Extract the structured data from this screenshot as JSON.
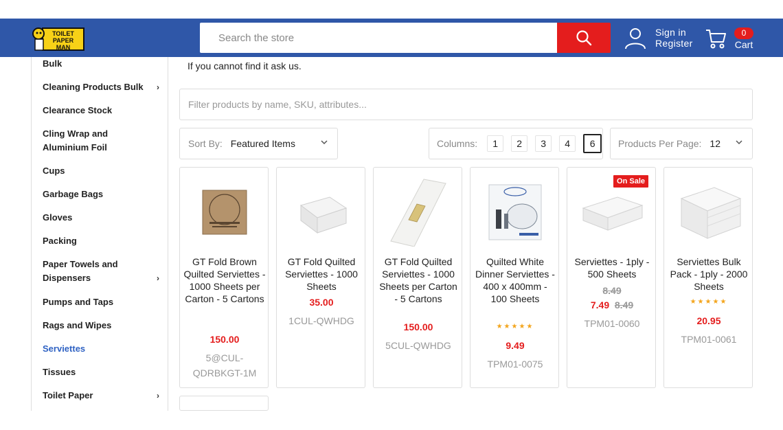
{
  "header": {
    "logo_text": "TOILET PAPER MAN",
    "search_placeholder": "Search the store",
    "sign_in": "Sign in",
    "register": "Register",
    "cart_label": "Cart",
    "cart_count": "0"
  },
  "colors": {
    "header_bg": "#2f57a8",
    "accent_red": "#e41d1d",
    "active_link": "#2f62c3",
    "star": "#f3a51d"
  },
  "sidebar": {
    "items": [
      {
        "label": "Bulk"
      },
      {
        "label": "Cleaning Products Bulk",
        "has_children": true
      },
      {
        "label": "Clearance Stock"
      },
      {
        "label": "Cling Wrap and Aluminium Foil"
      },
      {
        "label": "Cups"
      },
      {
        "label": "Garbage Bags"
      },
      {
        "label": "Gloves"
      },
      {
        "label": "Packing"
      },
      {
        "label": "Paper Towels and Dispensers",
        "has_children": true
      },
      {
        "label": "Pumps and Taps"
      },
      {
        "label": "Rags and Wipes"
      },
      {
        "label": "Serviettes",
        "active": true
      },
      {
        "label": "Tissues"
      },
      {
        "label": "Toilet Paper",
        "has_children": true
      }
    ]
  },
  "main": {
    "note": "If you cannot find it ask us.",
    "filter_placeholder": "Filter products by name, SKU, attributes...",
    "sort_label": "Sort By:",
    "sort_value": "Featured Items",
    "columns_label": "Columns:",
    "columns": [
      "1",
      "2",
      "3",
      "4",
      "6"
    ],
    "columns_selected": "6",
    "per_page_label": "Products Per Page:",
    "per_page_value": "12"
  },
  "products": [
    {
      "title": "GT Fold Brown Quilted Serviettes - 1000 Sheets per Carton - 5 Cartons",
      "price": "150.00",
      "sku": "5@CUL-QDRBKGT-1M",
      "image": "brown-serviette-pack"
    },
    {
      "title": "GT Fold Quilted Serviettes - 1000 Sheets",
      "price": "35.00",
      "sku": "1CUL-QWHDG",
      "image": "white-gt-fold-stack"
    },
    {
      "title": "GT Fold Quilted Serviettes - 1000 Sheets per Carton - 5 Cartons",
      "price": "150.00",
      "sku": "5CUL-QWHDG",
      "image": "white-sleeve-pack"
    },
    {
      "title": "Quilted White Dinner Serviettes - 400 x 400mm - 100 Sheets",
      "price": "9.49",
      "sku": "TPM01-0075",
      "rating": 5,
      "stars": "★★★★★",
      "image": "dinner-serviette-pack"
    },
    {
      "title": "Serviettes - 1ply - 500 Sheets",
      "price": "7.49",
      "old_price": "8.49",
      "rrp": "8.49",
      "sku": "TPM01-0060",
      "badge": "On Sale",
      "image": "white-napkin-stack"
    },
    {
      "title": "Serviettes Bulk Pack - 1ply - 2000 Sheets",
      "price": "20.95",
      "sku": "TPM01-0061",
      "rating": 5,
      "stars": "★★★★★",
      "image": "white-napkin-bulk"
    }
  ]
}
